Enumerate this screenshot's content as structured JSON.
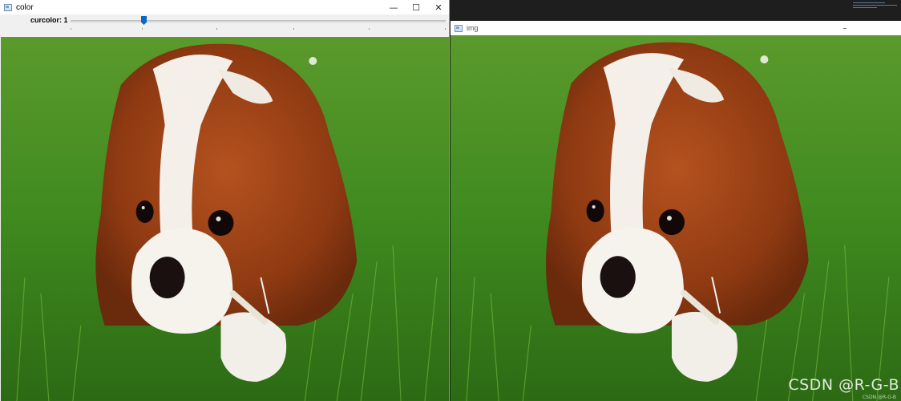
{
  "left_window": {
    "title": "color",
    "controls": {
      "minimize": "—",
      "maximize": "☐",
      "close": "✕"
    },
    "trackbar": {
      "label": "curcolor: 1",
      "value": 1
    }
  },
  "right_window": {
    "title": "img"
  },
  "watermark": {
    "text": "CSDN @R-G-B",
    "small_text": "CSDN @R-G-B"
  },
  "icons": [
    "window-app-icon",
    "minimize-icon",
    "maximize-icon",
    "close-icon"
  ]
}
